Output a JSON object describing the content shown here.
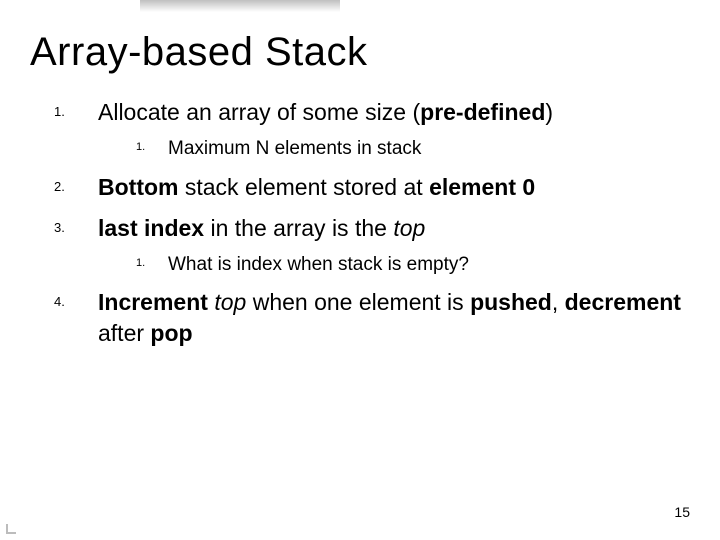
{
  "title": "Array-based Stack",
  "items": {
    "i1": {
      "plain1": "Allocate an array of some size (",
      "bold1": "pre-defined",
      "plain2": ")",
      "sub1": "Maximum N elements in stack"
    },
    "i2": {
      "bold1": "Bottom",
      "plain1": " stack element stored at ",
      "bold2": "element 0"
    },
    "i3": {
      "bold1": "last index",
      "plain1": " in the array is the ",
      "italic1": "top",
      "sub1": "What is index when stack is empty?"
    },
    "i4": {
      "bold1": "Increment ",
      "italic1": "top",
      "plain1": " when one element is ",
      "bold2": "pushed",
      "plain2": ", ",
      "bold3": "decrement",
      "plain3": " after ",
      "bold4": "pop"
    }
  },
  "page_number": "15"
}
